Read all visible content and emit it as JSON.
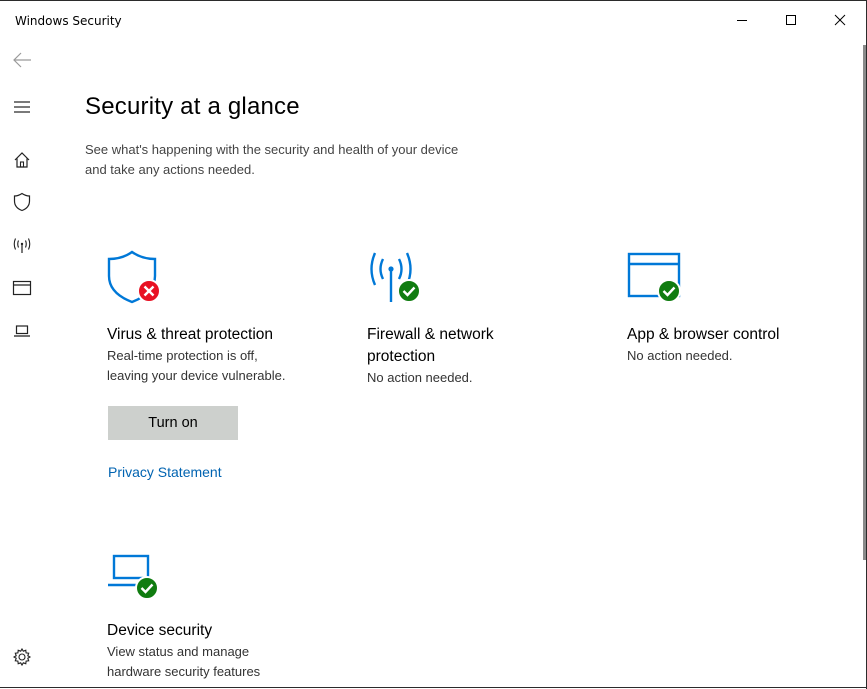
{
  "window": {
    "title": "Windows Security",
    "minimize_icon": "minimize-icon",
    "maximize_icon": "maximize-icon",
    "close_icon": "close-icon"
  },
  "sidebar": {
    "items": [
      {
        "icon": "back-arrow-icon"
      },
      {
        "icon": "hamburger-menu-icon"
      },
      {
        "icon": "home-icon"
      },
      {
        "icon": "shield-icon"
      },
      {
        "icon": "network-antenna-icon"
      },
      {
        "icon": "app-browser-icon"
      },
      {
        "icon": "laptop-icon"
      },
      {
        "icon": "gear-icon"
      }
    ]
  },
  "main": {
    "title": "Security at a glance",
    "subtitle_line1": "See what's happening with the security and health of your device",
    "subtitle_line2": "and take any actions needed."
  },
  "tiles": {
    "virus": {
      "title": "Virus & threat protection",
      "desc_line1": "Real-time protection is off,",
      "desc_line2": "leaving your device vulnerable.",
      "button": "Turn on",
      "link": "Privacy Statement",
      "status": "error"
    },
    "firewall": {
      "title_line1": "Firewall & network",
      "title_line2": "protection",
      "desc": "No action needed.",
      "status": "ok"
    },
    "app": {
      "title": "App & browser control",
      "desc": "No action needed.",
      "status": "ok"
    },
    "device": {
      "title": "Device security",
      "desc_line1": "View status and manage",
      "desc_line2": "hardware security features",
      "status": "ok"
    }
  },
  "colors": {
    "accent_blue": "#0078d7",
    "ok_green": "#107c10",
    "error_red": "#e81123",
    "link_blue": "#0063b1",
    "button_gray": "#cdd0cd"
  }
}
